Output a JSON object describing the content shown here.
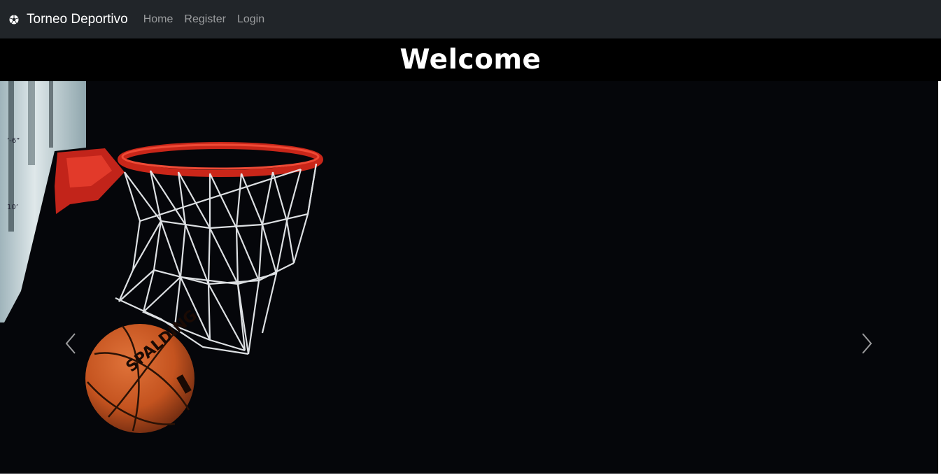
{
  "navbar": {
    "brand": {
      "icon": "soccer-ball-icon",
      "text": "Torneo Deportivo"
    },
    "links": [
      {
        "label": "Home"
      },
      {
        "label": "Register"
      },
      {
        "label": "Login"
      }
    ]
  },
  "hero": {
    "title": "Welcome"
  },
  "carousel": {
    "image": "basketball-hoop-image",
    "prev_icon": "chevron-left-icon",
    "next_icon": "chevron-right-icon"
  },
  "colors": {
    "navbar_bg": "#212529",
    "page_bg": "#000000",
    "rim_red": "#d0281c",
    "ball_orange": "#c4531f"
  }
}
